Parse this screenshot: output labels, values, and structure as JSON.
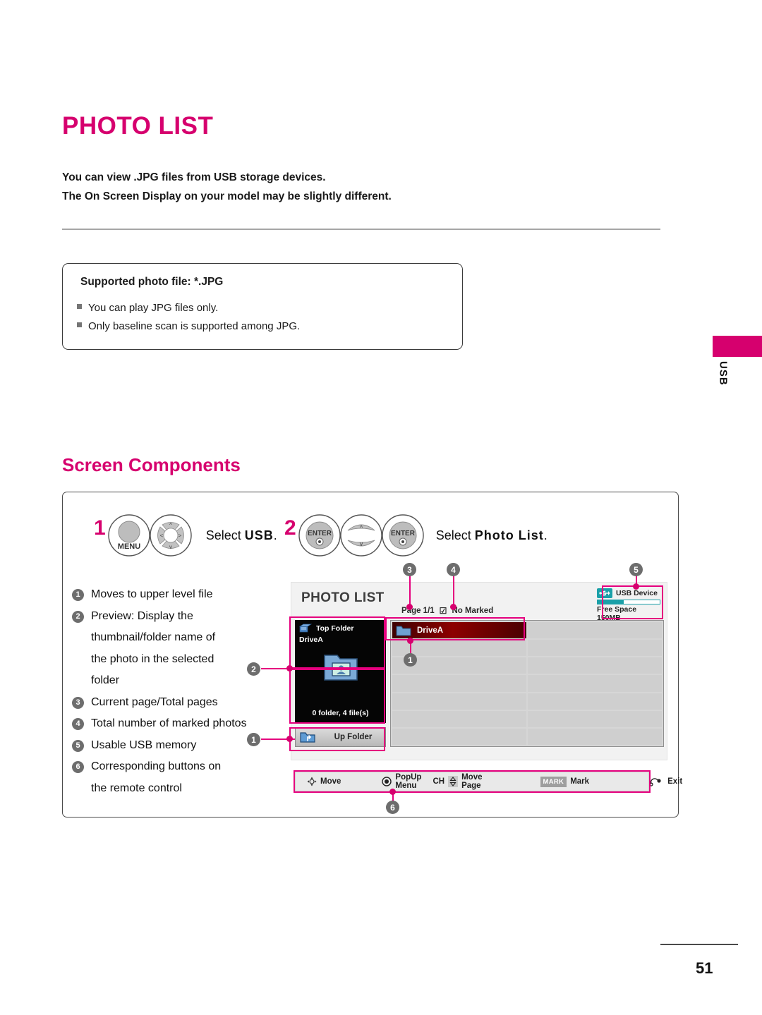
{
  "document": {
    "title": "PHOTO LIST",
    "intro_lines": [
      "You can view .JPG files from USB storage devices.",
      "The On Screen Display on your model may be slightly different."
    ],
    "page_number": "51",
    "side_tab_label": "USB"
  },
  "note_box": {
    "title": "Supported photo file: *.JPG",
    "items": [
      "You can play JPG files only.",
      "Only baseline scan is supported among JPG."
    ]
  },
  "section": {
    "heading": "Screen Components"
  },
  "steps": [
    {
      "number": "1",
      "text_prefix": "Select ",
      "text_bold": "USB",
      "text_suffix": ".",
      "buttons": [
        "MENU",
        "nav-pad"
      ]
    },
    {
      "number": "2",
      "text_prefix": "Select ",
      "text_bold": "Photo List",
      "text_suffix": ".",
      "buttons": [
        "ENTER",
        "ch-updown",
        "ENTER"
      ]
    }
  ],
  "legend": [
    {
      "num": "1",
      "text": "Moves to upper level file"
    },
    {
      "num": "2",
      "text": "Preview: Display the\nthumbnail/folder name of\nthe photo in the selected\nfolder"
    },
    {
      "num": "3",
      "text": "Current page/Total pages"
    },
    {
      "num": "4",
      "text": "Total number of marked photos"
    },
    {
      "num": "5",
      "text": "Usable USB memory"
    },
    {
      "num": "6",
      "text": "Corresponding buttons on\nthe remote control"
    }
  ],
  "tv_screen": {
    "title": "PHOTO LIST",
    "page_status": "Page 1/1",
    "marked_status": "No Marked",
    "marked_check_glyph": "☑",
    "usb": {
      "device_label": "USB Device",
      "free_space": "Free Space 150MB",
      "bar_fill_percent": 42,
      "accent_color": "#1aa0a8"
    },
    "preview": {
      "header_label": "Top Folder",
      "drive_name": "DriveA",
      "count_text": "0 folder, 4 file(s)"
    },
    "up_folder_label": "Up Folder",
    "file_grid": {
      "columns": 2,
      "rows": 7,
      "selected_item": "DriveA",
      "selected_highlight_color": "#8d0000"
    },
    "hint_bar": [
      {
        "icon": "dpad-icon",
        "label": "Move"
      },
      {
        "icon": "enter-circle-icon",
        "label": "PopUp Menu"
      },
      {
        "icon": "ch-updown-icon",
        "prefix": "CH",
        "label": "Move Page"
      },
      {
        "icon": "mark-key-icon",
        "key": "MARK",
        "label": "Mark"
      },
      {
        "icon": "exit-icon",
        "label": "Exit"
      }
    ]
  },
  "callouts": {
    "accent": "#e5007e",
    "markers": [
      "1",
      "2",
      "3",
      "4",
      "5",
      "6"
    ]
  }
}
